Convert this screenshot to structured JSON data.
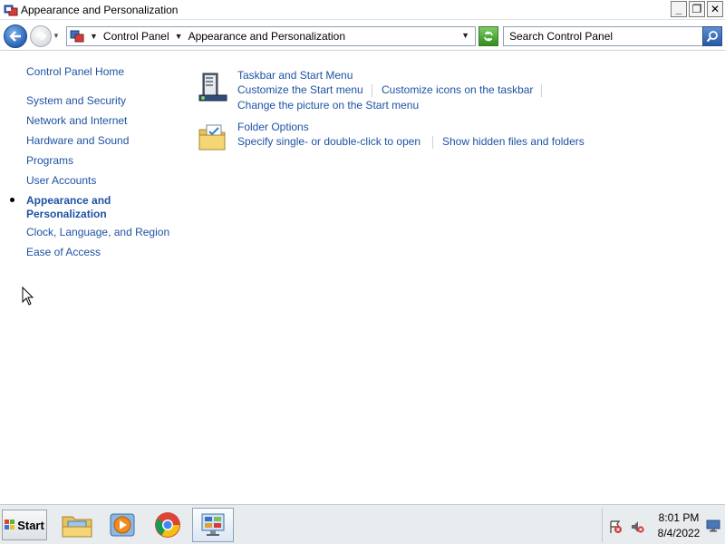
{
  "window": {
    "title": "Appearance and Personalization",
    "minimize_glyph": "_",
    "maximize_glyph": "❐",
    "close_glyph": "✕"
  },
  "addressbar": {
    "crumbs": [
      "Control Panel",
      "Appearance and Personalization"
    ],
    "search_placeholder": "Search Control Panel"
  },
  "leftnav": {
    "home": "Control Panel Home",
    "items": [
      "System and Security",
      "Network and Internet",
      "Hardware and Sound",
      "Programs",
      "User Accounts",
      "Appearance and Personalization",
      "Clock, Language, and Region",
      "Ease of Access"
    ],
    "current_line1": "Appearance and",
    "current_line2": "Personalization"
  },
  "categories": [
    {
      "title": "Taskbar and Start Menu",
      "icon": "taskbar-icon",
      "links": [
        "Customize the Start menu",
        "Customize icons on the taskbar",
        "Change the picture on the Start menu"
      ]
    },
    {
      "title": "Folder Options",
      "icon": "folder-options-icon",
      "links": [
        "Specify single- or double-click to open",
        "Show hidden files and folders"
      ]
    }
  ],
  "taskbar": {
    "start_label": "Start",
    "apps": [
      "file-explorer-icon",
      "media-player-icon",
      "chrome-icon",
      "control-panel-icon"
    ],
    "clock_time": "8:01 PM",
    "clock_date": "8/4/2022"
  },
  "colors": {
    "link": "#1e52a3",
    "accent": "#2a63b8"
  }
}
